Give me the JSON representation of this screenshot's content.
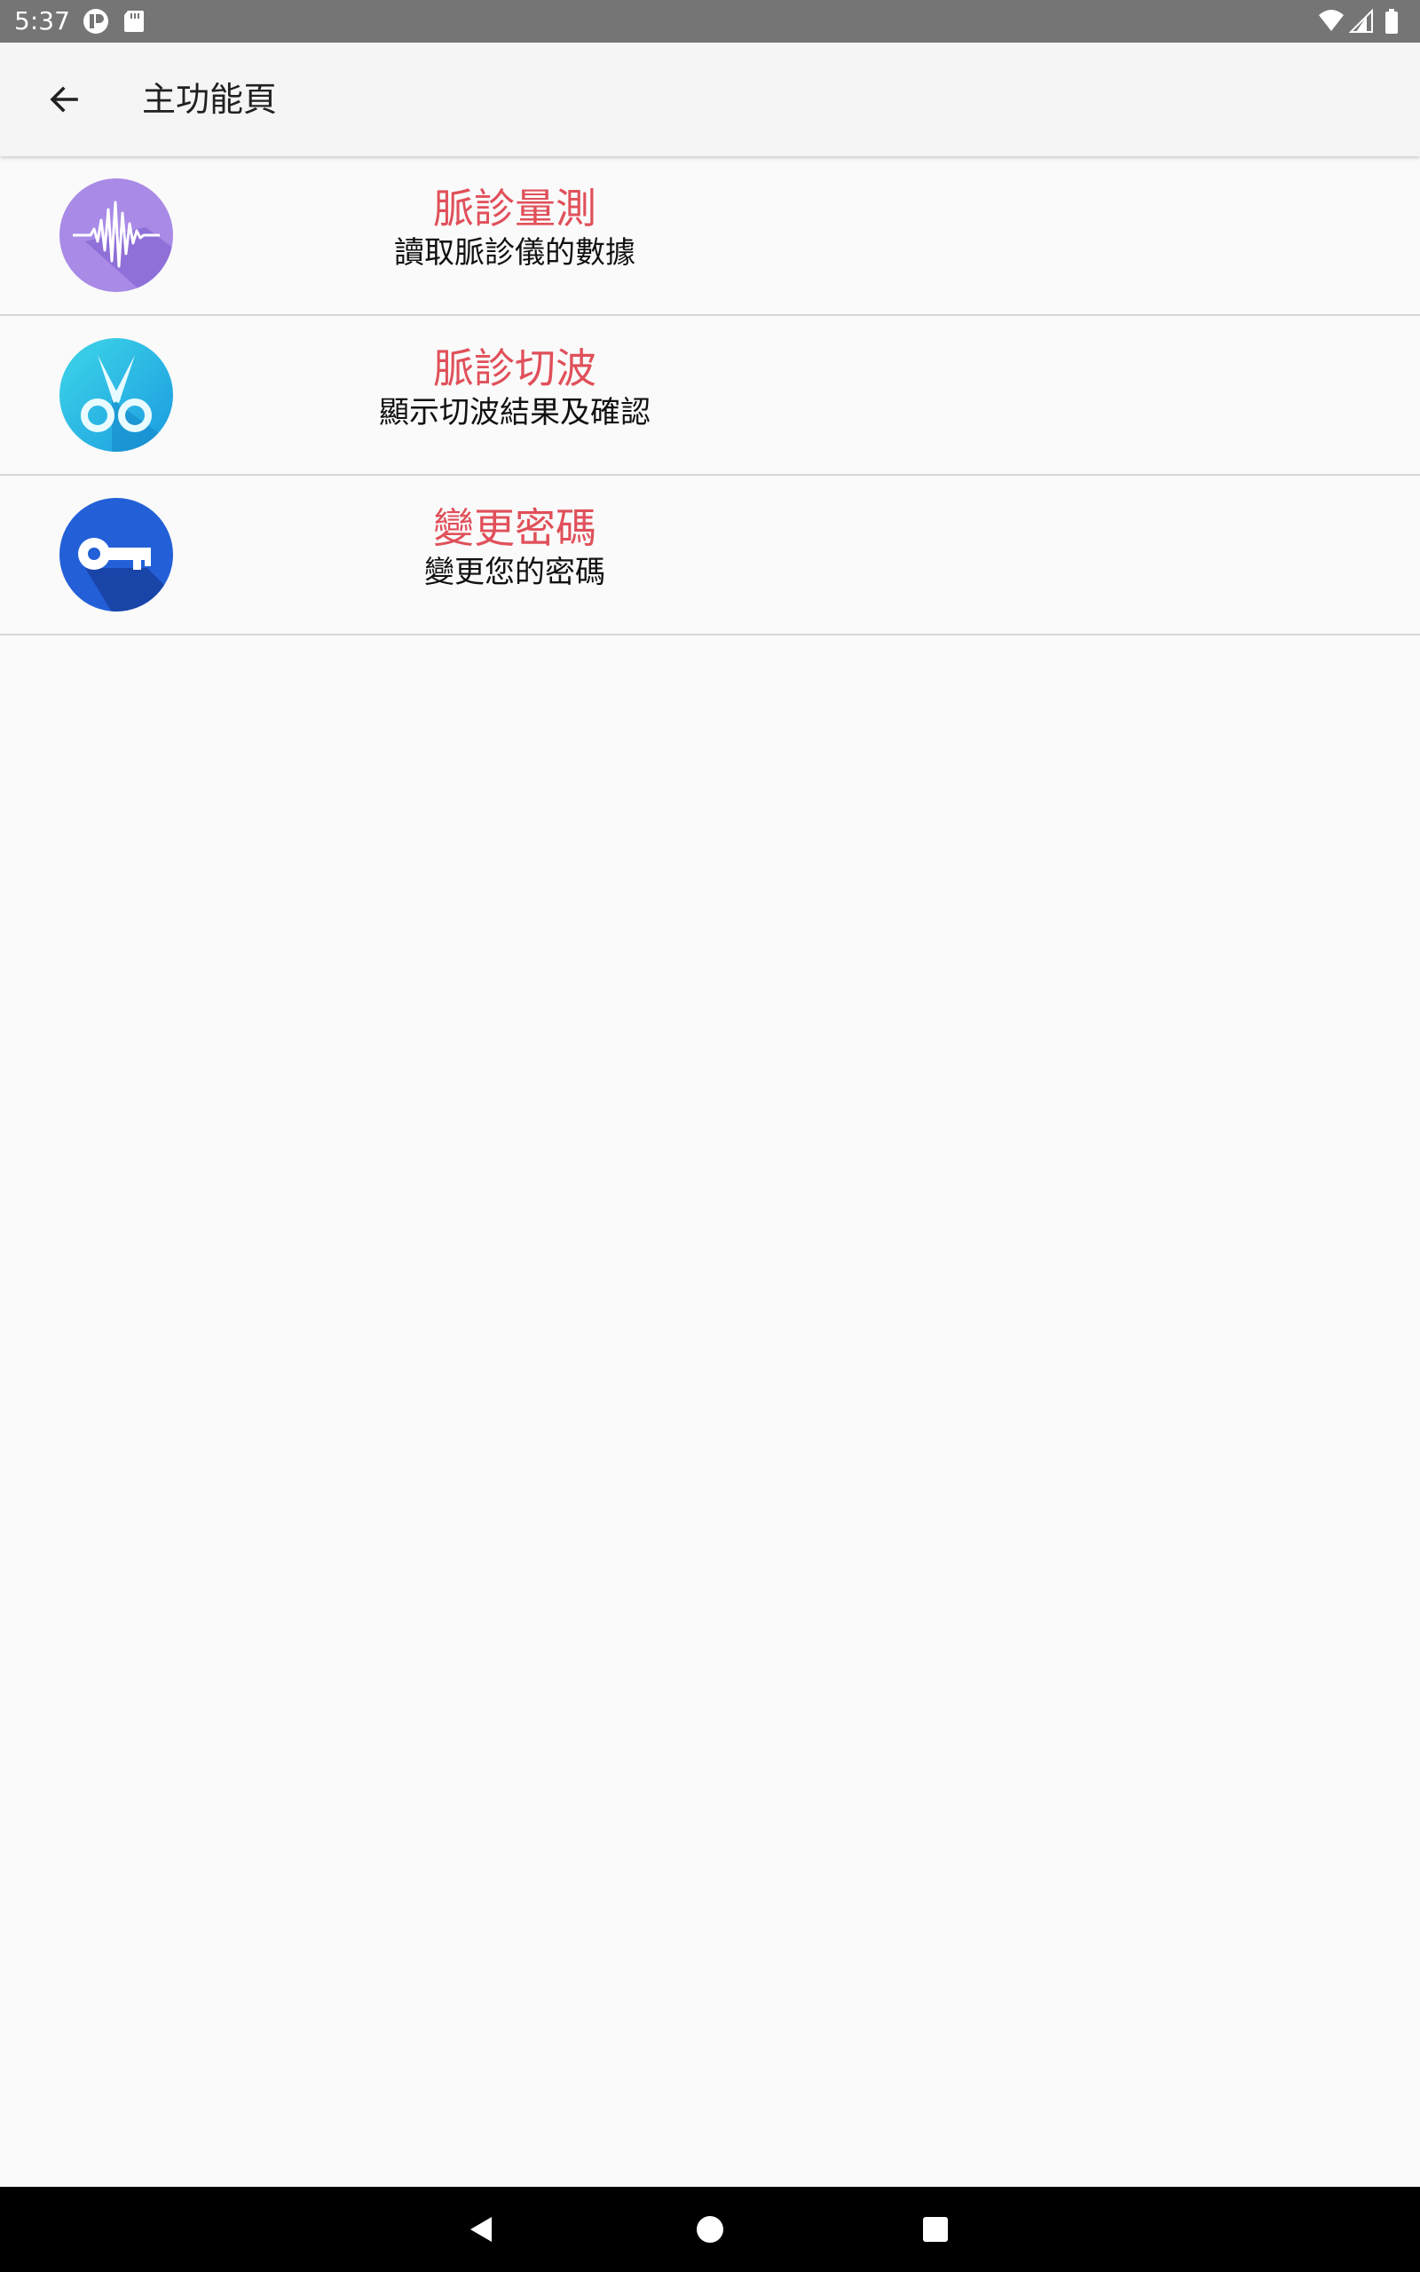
{
  "status_bar": {
    "time": "5:37",
    "icons_left": [
      "notification-app-icon",
      "sd-card-icon"
    ],
    "icons_right": [
      "wifi-icon",
      "cell-signal-icon",
      "battery-icon"
    ],
    "color": "#757575"
  },
  "toolbar": {
    "back_icon": "arrow-left-icon",
    "title": "主功能頁"
  },
  "menu": {
    "items": [
      {
        "title": "脈診量測",
        "subtitle": "讀取脈診儀的數據",
        "icon": "waveform-icon",
        "icon_color": "#9c7ce0"
      },
      {
        "title": "脈診切波",
        "subtitle": "顯示切波結果及確認",
        "icon": "scissors-icon",
        "icon_color": "#2ab7e6"
      },
      {
        "title": "變更密碼",
        "subtitle": "變更您的密碼",
        "icon": "key-icon",
        "icon_color": "#1f5fd6"
      }
    ]
  },
  "colors": {
    "accent_text": "#e0505a",
    "background": "#fafafa",
    "toolbar_bg": "#f5f5f5"
  },
  "nav_bar": {
    "buttons": [
      "back-triangle-icon",
      "home-circle-icon",
      "recents-square-icon"
    ]
  }
}
